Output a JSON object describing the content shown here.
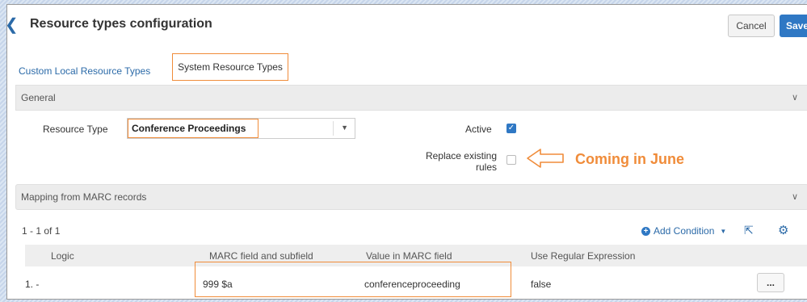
{
  "header": {
    "back_icon": "chevron-left-icon",
    "title": "Resource types configuration",
    "cancel_label": "Cancel",
    "save_label": "Save"
  },
  "tabs": [
    {
      "label": "Custom Local Resource Types",
      "active": false
    },
    {
      "label": "System Resource Types",
      "active": true
    }
  ],
  "general": {
    "section_label": "General",
    "resource_type_label": "Resource Type",
    "resource_type_value": "Conference Proceedings",
    "active_label": "Active",
    "active_checked": true,
    "replace_label_line1": "Replace existing",
    "replace_label_line2": "rules",
    "replace_checked": false,
    "annotation": "Coming in June"
  },
  "mapping": {
    "section_label": "Mapping from MARC records",
    "count": "1 - 1 of 1",
    "add_condition_label": "Add Condition",
    "columns": [
      "Logic",
      "MARC field and subfield",
      "Value in MARC field",
      "Use Regular Expression"
    ],
    "rows": [
      {
        "logic": "1. -",
        "marc_field": "999 $a",
        "value": "conferenceproceeding",
        "regex": "false",
        "actions": "..."
      }
    ]
  },
  "colors": {
    "accent": "#2f78c4",
    "highlight": "#f08c3a"
  }
}
